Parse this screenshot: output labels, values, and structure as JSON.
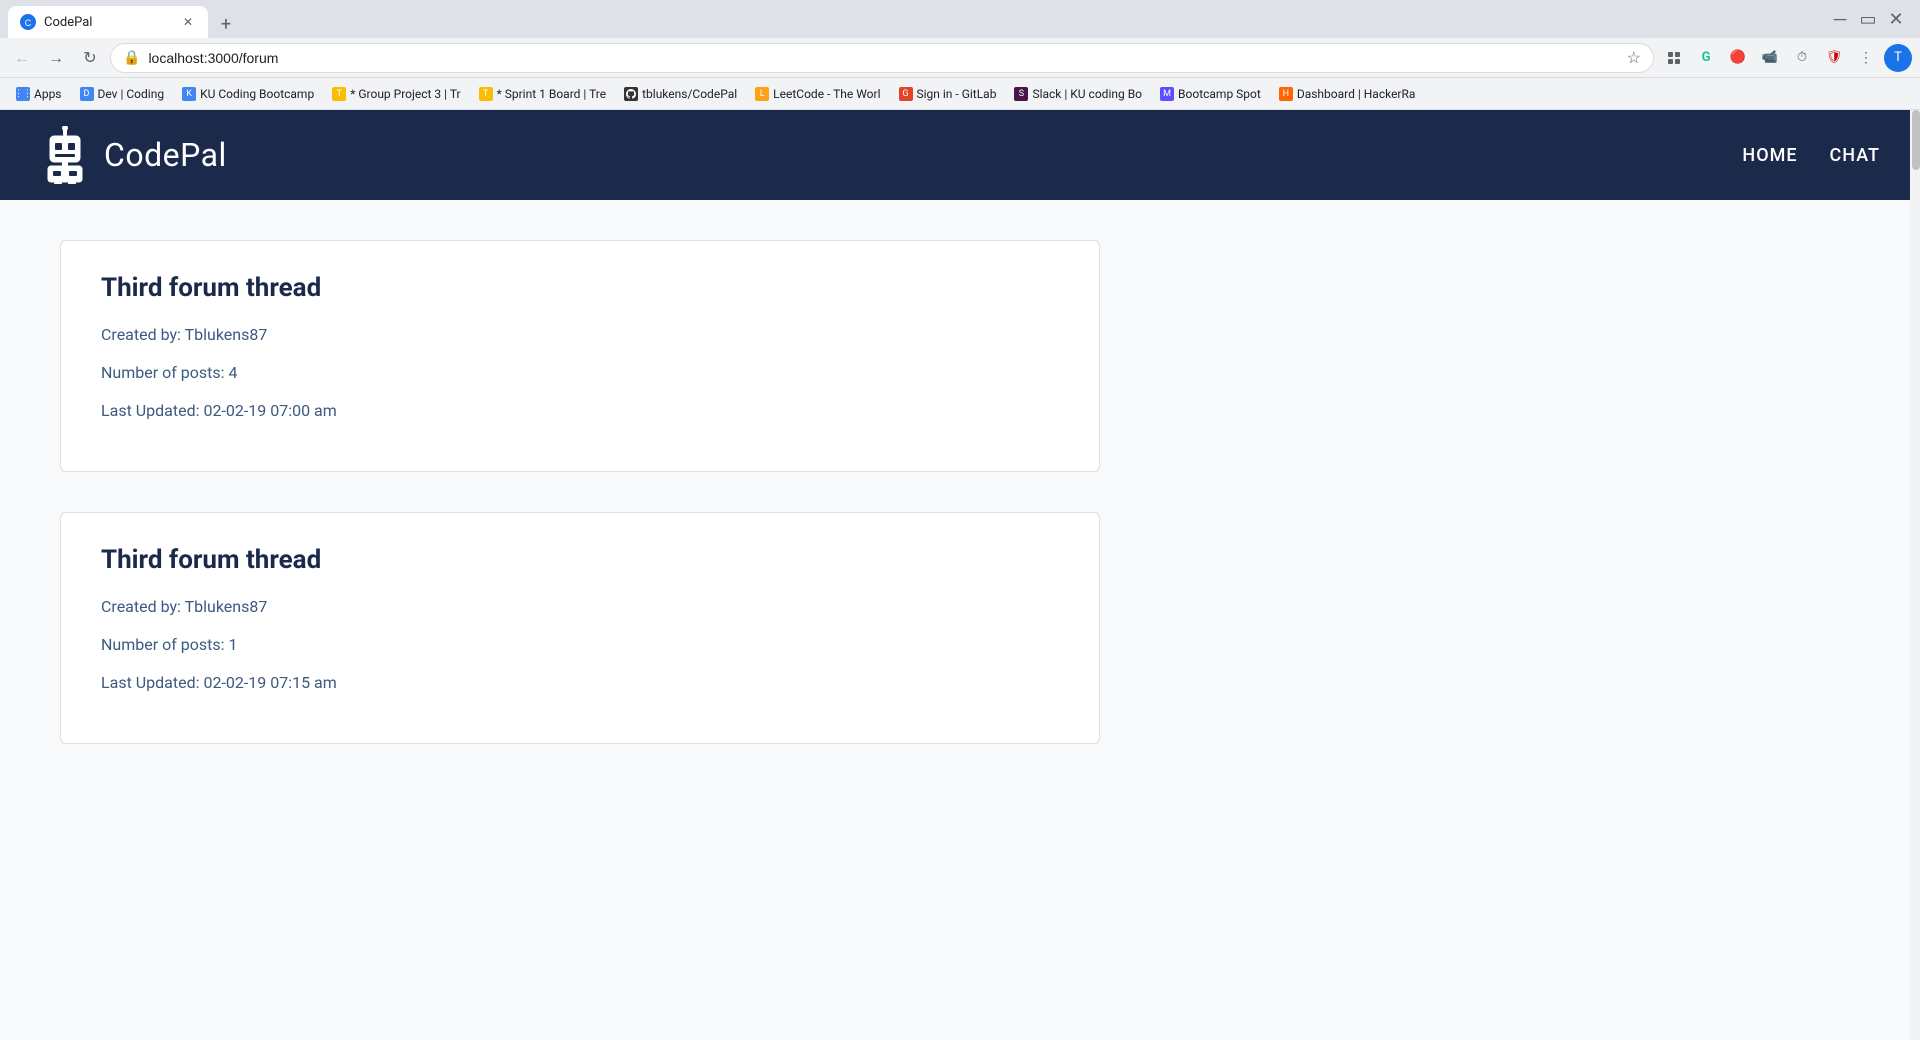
{
  "browser": {
    "tab": {
      "title": "CodePal",
      "favicon": "C",
      "url": "localhost:3000/forum"
    },
    "toolbar": {
      "back_disabled": false,
      "forward_disabled": true,
      "address": "localhost:3000/forum"
    },
    "bookmarks": [
      {
        "id": "apps",
        "label": "Apps",
        "type": "apps"
      },
      {
        "id": "dev-coding",
        "label": "Dev | Coding",
        "type": "blue"
      },
      {
        "id": "ku-bootcamp",
        "label": "KU Coding Bootcamp",
        "type": "blue"
      },
      {
        "id": "group-project",
        "label": "* Group Project 3 | Tr",
        "type": "yellow"
      },
      {
        "id": "sprint-board",
        "label": "* Sprint 1 Board | Tre",
        "type": "yellow"
      },
      {
        "id": "tblukens-codepal",
        "label": "tblukens/CodePal",
        "type": "github"
      },
      {
        "id": "leetcode",
        "label": "LeetCode - The Worl",
        "type": "leet"
      },
      {
        "id": "gitlab",
        "label": "Sign in - GitLab",
        "type": "fox"
      },
      {
        "id": "slack-coding",
        "label": "Slack | KU coding Bo",
        "type": "slack"
      },
      {
        "id": "bootcamp-spot",
        "label": "Bootcamp Spot",
        "type": "mv"
      },
      {
        "id": "hackerrank",
        "label": "Dashboard | HackerRa",
        "type": "hacker"
      }
    ]
  },
  "app": {
    "title": "CodePal",
    "nav": {
      "home": "HOME",
      "chat": "CHAT"
    },
    "forum_threads": [
      {
        "id": 1,
        "title": "Third forum thread",
        "created_by": "Created by: Tblukens87",
        "num_posts": "Number of posts: 4",
        "last_updated": "Last Updated: 02-02-19 07:00 am"
      },
      {
        "id": 2,
        "title": "Third forum thread",
        "created_by": "Created by: Tblukens87",
        "num_posts": "Number of posts: 1",
        "last_updated": "Last Updated: 02-02-19 07:15 am"
      }
    ]
  }
}
